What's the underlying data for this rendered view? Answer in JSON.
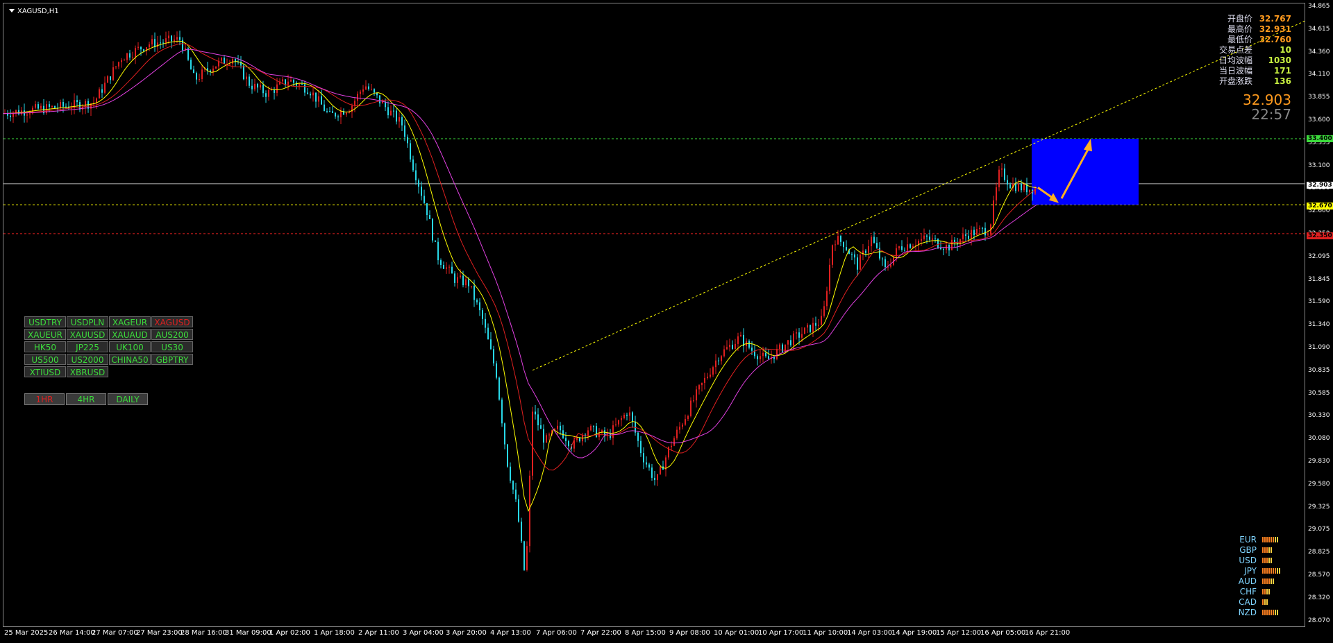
{
  "window": {
    "title": "XAGUSD,H1"
  },
  "colors": {
    "bull": "#e02020",
    "bear": "#28d8e8",
    "ma_fast": "#ffff00",
    "ma_mid": "#e02020",
    "ma_slow": "#e040e0",
    "resistance": "#3cdc3c",
    "support": "#ffff00",
    "stop": "#e02020",
    "zone": "#0000ff",
    "arrow": "#ffb020",
    "trend": "#ffff00"
  },
  "price_axis": {
    "ticks": [
      "34.865",
      "34.615",
      "34.360",
      "34.110",
      "33.855",
      "33.600",
      "33.355",
      "33.100",
      "32.850",
      "32.600",
      "32.350",
      "32.095",
      "31.845",
      "31.590",
      "31.340",
      "31.090",
      "30.835",
      "30.585",
      "30.330",
      "30.080",
      "29.830",
      "29.580",
      "29.325",
      "29.075",
      "28.825",
      "28.570",
      "28.320",
      "28.070"
    ],
    "resistance_tag": "33.400",
    "current_tag": "32.903",
    "support_tag": "32.670",
    "stop_tag": "32.350"
  },
  "time_axis": [
    "25 Mar 2025",
    "26 Mar 14:00",
    "27 Mar 07:00",
    "27 Mar 23:00",
    "28 Mar 16:00",
    "31 Mar 09:00",
    "1 Apr 02:00",
    "1 Apr 18:00",
    "2 Apr 11:00",
    "3 Apr 04:00",
    "3 Apr 20:00",
    "4 Apr 13:00",
    "7 Apr 06:00",
    "7 Apr 22:00",
    "8 Apr 15:00",
    "9 Apr 08:00",
    "10 Apr 01:00",
    "10 Apr 17:00",
    "11 Apr 10:00",
    "14 Apr 03:00",
    "14 Apr 19:00",
    "15 Apr 12:00",
    "16 Apr 05:00",
    "16 Apr 21:00"
  ],
  "info_panel": [
    {
      "label": "开盘价",
      "value": "32.767",
      "color": "#ff9a1e"
    },
    {
      "label": "最高价",
      "value": "32.931",
      "color": "#ff9a1e"
    },
    {
      "label": "最低价",
      "value": "32.760",
      "color": "#ff9a1e"
    },
    {
      "label": "交易点差",
      "value": "10",
      "color": "#c8f040"
    },
    {
      "label": "日均波幅",
      "value": "1030",
      "color": "#c8f040"
    },
    {
      "label": "当日波幅",
      "value": "171",
      "color": "#c8f040"
    },
    {
      "label": "开盘涨跌",
      "value": "136",
      "color": "#c8f040"
    }
  ],
  "big_price": "32.903",
  "big_time": "22:57",
  "symbols": [
    {
      "label": "USDTRY",
      "active": false
    },
    {
      "label": "USDPLN",
      "active": false
    },
    {
      "label": "XAGEUR",
      "active": false
    },
    {
      "label": "XAGUSD",
      "active": true
    },
    {
      "label": "XAUEUR",
      "active": false
    },
    {
      "label": "XAUUSD",
      "active": false
    },
    {
      "label": "XAUAUD",
      "active": false
    },
    {
      "label": "AUS200",
      "active": false
    },
    {
      "label": "HK50",
      "active": false
    },
    {
      "label": "JP225",
      "active": false
    },
    {
      "label": "UK100",
      "active": false
    },
    {
      "label": "US30",
      "active": false
    },
    {
      "label": "US500",
      "active": false
    },
    {
      "label": "US2000",
      "active": false
    },
    {
      "label": "CHINA50",
      "active": false
    },
    {
      "label": "GBPTRY",
      "active": false
    },
    {
      "label": "XTIUSD",
      "active": false
    },
    {
      "label": "XBRUSD",
      "active": false
    }
  ],
  "timeframes": [
    {
      "label": "1HR",
      "active": true
    },
    {
      "label": "4HR",
      "active": false
    },
    {
      "label": "DAILY",
      "active": false
    }
  ],
  "currency_strength": [
    {
      "code": "EUR",
      "level": 8
    },
    {
      "code": "GBP",
      "level": 5
    },
    {
      "code": "USD",
      "level": 5
    },
    {
      "code": "JPY",
      "level": 9
    },
    {
      "code": "AUD",
      "level": 6
    },
    {
      "code": "CHF",
      "level": 4
    },
    {
      "code": "CAD",
      "level": 3
    },
    {
      "code": "NZD",
      "level": 8
    }
  ]
}
